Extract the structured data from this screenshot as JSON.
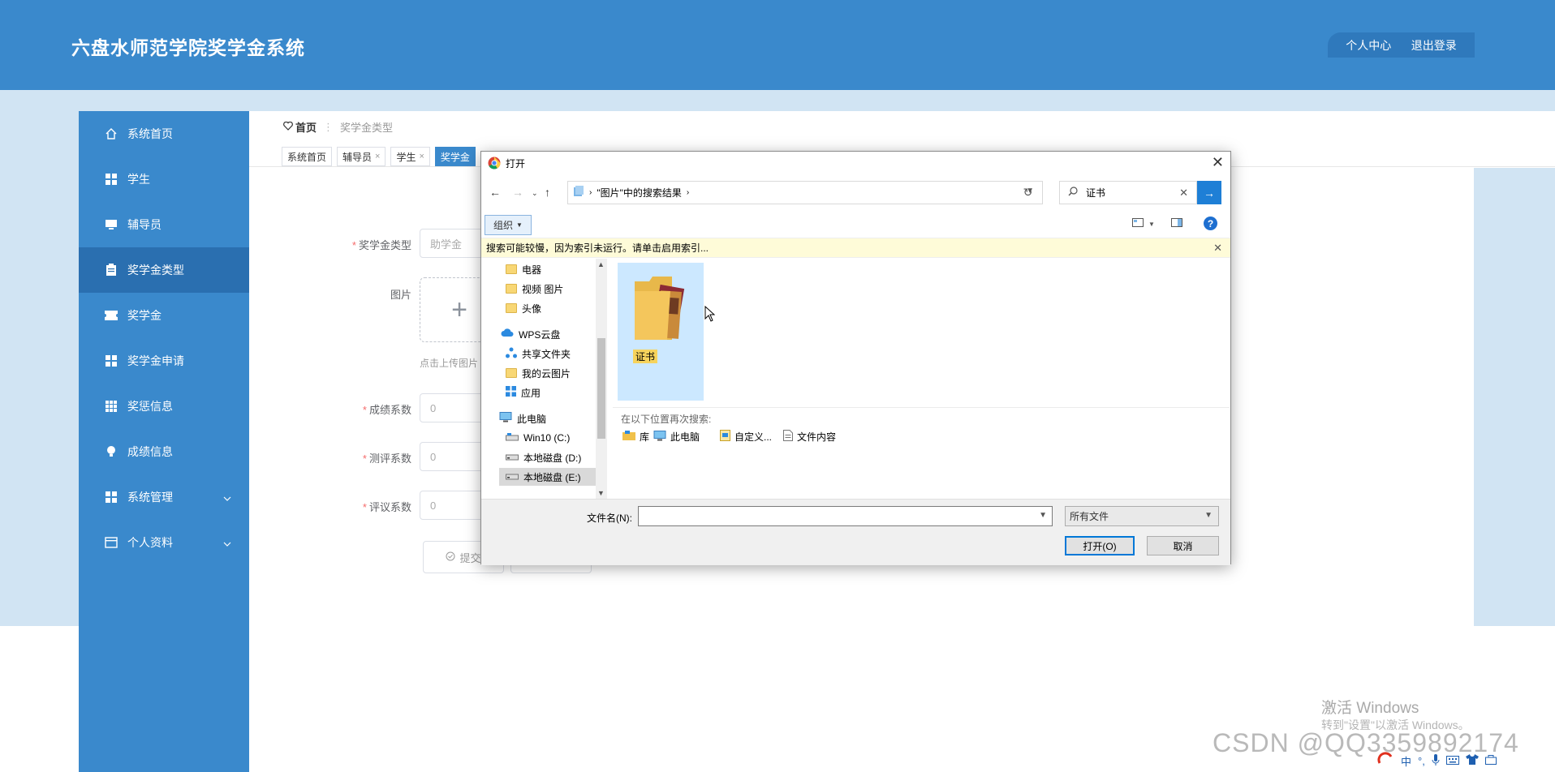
{
  "header": {
    "title": "六盘水师范学院奖学金系统",
    "personal_center": "个人中心",
    "logout": "退出登录"
  },
  "sidebar": {
    "items": [
      {
        "label": "系统首页",
        "icon": "home-icon"
      },
      {
        "label": "学生",
        "icon": "grid-icon"
      },
      {
        "label": "辅导员",
        "icon": "monitor-icon"
      },
      {
        "label": "奖学金类型",
        "icon": "clipboard-icon"
      },
      {
        "label": "奖学金",
        "icon": "ticket-icon"
      },
      {
        "label": "奖学金申请",
        "icon": "grid-icon"
      },
      {
        "label": "奖惩信息",
        "icon": "table-icon"
      },
      {
        "label": "成绩信息",
        "icon": "bulb-icon"
      },
      {
        "label": "系统管理",
        "icon": "grid-icon"
      },
      {
        "label": "个人资料",
        "icon": "card-icon"
      }
    ]
  },
  "breadcrumb": {
    "home": "首页",
    "separator": "⋮",
    "current": "奖学金类型"
  },
  "tabs": [
    {
      "label": "系统首页",
      "close": ""
    },
    {
      "label": "辅导员",
      "close": "×"
    },
    {
      "label": "学生",
      "close": "×"
    },
    {
      "label": "奖学金",
      "close": ""
    }
  ],
  "form": {
    "type_label": "奖学金类型",
    "type_placeholder": "助学金",
    "image_label": "图片",
    "upload_plus": "+",
    "upload_hint": "点击上传图片",
    "grade_label": "成绩系数",
    "grade_value": "0",
    "eval_label": "测评系数",
    "eval_value": "0",
    "review_label": "评议系数",
    "review_value": "0",
    "submit": "提交",
    "required_mark": "*"
  },
  "dialog": {
    "title": "打开",
    "close": "✕",
    "address": "\"图片\"中的搜索结果",
    "search_value": "证书",
    "organize": "组织",
    "info": "搜索可能较慢，因为索引未运行。请单击启用索引...",
    "nav_items": [
      {
        "label": "电器",
        "type": "folder"
      },
      {
        "label": "视频 图片",
        "type": "folder"
      },
      {
        "label": "头像",
        "type": "folder"
      },
      {
        "label": "WPS云盘",
        "type": "cloud"
      },
      {
        "label": "共享文件夹",
        "type": "share"
      },
      {
        "label": "我的云图片",
        "type": "folder"
      },
      {
        "label": "应用",
        "type": "apps"
      },
      {
        "label": "此电脑",
        "type": "pc"
      },
      {
        "label": "Win10 (C:)",
        "type": "drive"
      },
      {
        "label": "本地磁盘 (D:)",
        "type": "drive"
      },
      {
        "label": "本地磁盘 (E:)",
        "type": "drive"
      }
    ],
    "result_item": "证书",
    "search_again": "在以下位置再次搜索:",
    "locations": [
      "库",
      "此电脑",
      "自定义...",
      "文件内容"
    ],
    "filename_label": "文件名(N):",
    "filename_value": "",
    "filetype": "所有文件",
    "open": "打开(O)",
    "cancel": "取消"
  },
  "watermark": {
    "activate": "激活 Windows",
    "activate_hint": "转到\"设置\"以激活 Windows。",
    "csdn": "CSDN @QQ3359892174"
  },
  "tray": {
    "ime": "中"
  },
  "colors": {
    "primary": "#3a89cc",
    "sidebar_active": "#2a6fb0",
    "band": "#d1e4f3"
  }
}
